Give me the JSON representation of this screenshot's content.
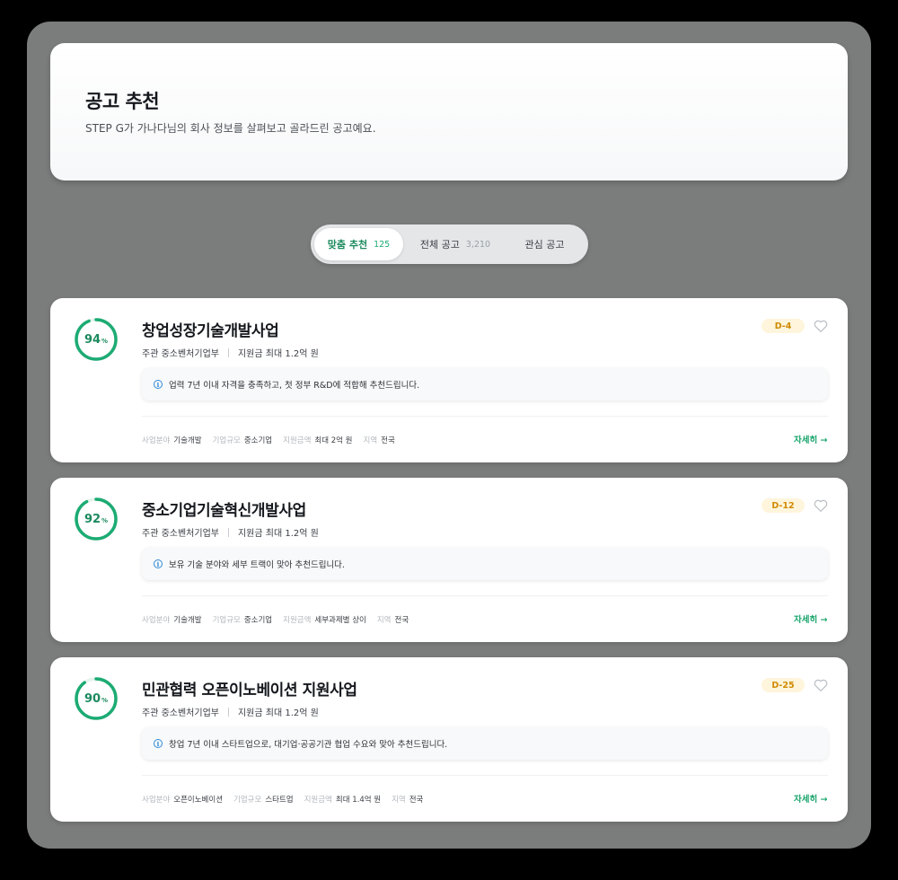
{
  "header": {
    "title": "공고 추천",
    "subtitle": "STEP G가 가나다님의 회사 정보를 살펴보고 골라드린 공고예요."
  },
  "tabs": [
    {
      "label": "맞춤 추천",
      "count": "125",
      "active": true
    },
    {
      "label": "전체 공고",
      "count": "3,210",
      "active": false
    },
    {
      "label": "관심 공고",
      "count": "",
      "active": false
    }
  ],
  "colors": {
    "accent": "#1cab73",
    "ring_track": "#e6f4ee",
    "dday_bg": "#fff5dc",
    "dday_text": "#d08a00"
  },
  "cards": [
    {
      "match": 94,
      "match_text": "94",
      "match_unit": "%",
      "title": "창업성장기술개발사업",
      "org": "주관 중소벤처기업부",
      "fund": "지원금 최대 1.2억 원",
      "dday": "D-4",
      "reason": "업력 7년 이내 자격을 충족하고, 첫 정부 R&D에 적합해 추천드립니다.",
      "tags": [
        {
          "key": "사업분야",
          "value": "기술개발"
        },
        {
          "key": "기업규모",
          "value": "중소기업"
        },
        {
          "key": "지원금액",
          "value": "최대 2억 원"
        },
        {
          "key": "지역",
          "value": "전국"
        }
      ],
      "more": "자세히 →"
    },
    {
      "match": 92,
      "match_text": "92",
      "match_unit": "%",
      "title": "중소기업기술혁신개발사업",
      "org": "주관 중소벤처기업부",
      "fund": "지원금 최대 1.2억 원",
      "dday": "D-12",
      "reason": "보유 기술 분야와 세부 트랙이 맞아 추천드립니다.",
      "tags": [
        {
          "key": "사업분야",
          "value": "기술개발"
        },
        {
          "key": "기업규모",
          "value": "중소기업"
        },
        {
          "key": "지원금액",
          "value": "세부과제별 상이"
        },
        {
          "key": "지역",
          "value": "전국"
        }
      ],
      "more": "자세히 →"
    },
    {
      "match": 90,
      "match_text": "90",
      "match_unit": "%",
      "title": "민관협력 오픈이노베이션 지원사업",
      "org": "주관 중소벤처기업부",
      "fund": "지원금 최대 1.2억 원",
      "dday": "D-25",
      "reason": "창업 7년 이내 스타트업으로, 대기업·공공기관 협업 수요와 맞아 추천드립니다.",
      "tags": [
        {
          "key": "사업분야",
          "value": "오픈이노베이션"
        },
        {
          "key": "기업규모",
          "value": "스타트업"
        },
        {
          "key": "지원금액",
          "value": "최대 1.4억 원"
        },
        {
          "key": "지역",
          "value": "전국"
        }
      ],
      "more": "자세히 →"
    }
  ]
}
